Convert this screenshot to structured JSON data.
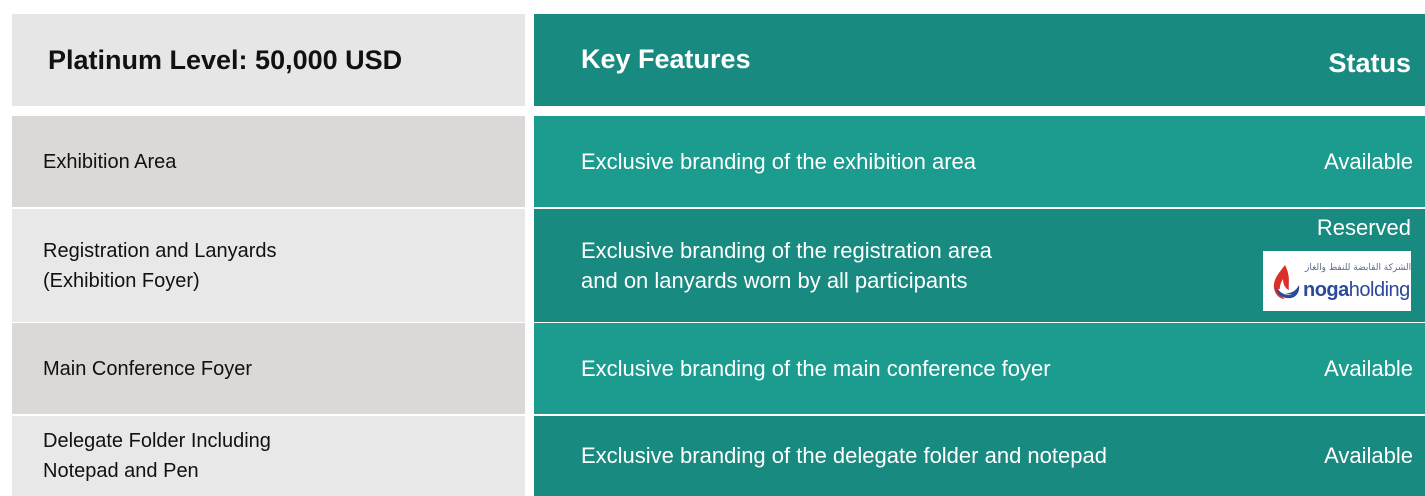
{
  "header": {
    "level_title": "Platinum Level: 50,000 USD",
    "features_heading": "Key Features",
    "status_heading": "Status"
  },
  "rows": [
    {
      "label_lines": [
        "Exhibition Area"
      ],
      "feature_lines": [
        "Exclusive branding of the exhibition area"
      ],
      "status": "Available"
    },
    {
      "label_lines": [
        "Registration and Lanyards",
        "(Exhibition Foyer)"
      ],
      "feature_lines": [
        "Exclusive branding of the registration area",
        "and on lanyards worn by all participants"
      ],
      "status": "Reserved",
      "sponsor_logo": {
        "arabic_text": "الشركة القابضة للنفط والغاز",
        "name_part1": "noga",
        "name_part2": "holding",
        "icon": "flame-icon"
      }
    },
    {
      "label_lines": [
        "Main Conference Foyer"
      ],
      "feature_lines": [
        "Exclusive branding of the main conference foyer"
      ],
      "status": "Available"
    },
    {
      "label_lines": [
        "Delegate Folder Including",
        "Notepad and Pen"
      ],
      "feature_lines": [
        "Exclusive branding of the delegate folder and notepad"
      ],
      "status": "Available"
    }
  ],
  "colors": {
    "header_teal": "#198a80",
    "row_teal_light": "#1b9c8f",
    "row_teal_dark": "#188a80",
    "label_bg_dark": "#dcd8d7",
    "label_bg_light": "#e9e8e9"
  }
}
